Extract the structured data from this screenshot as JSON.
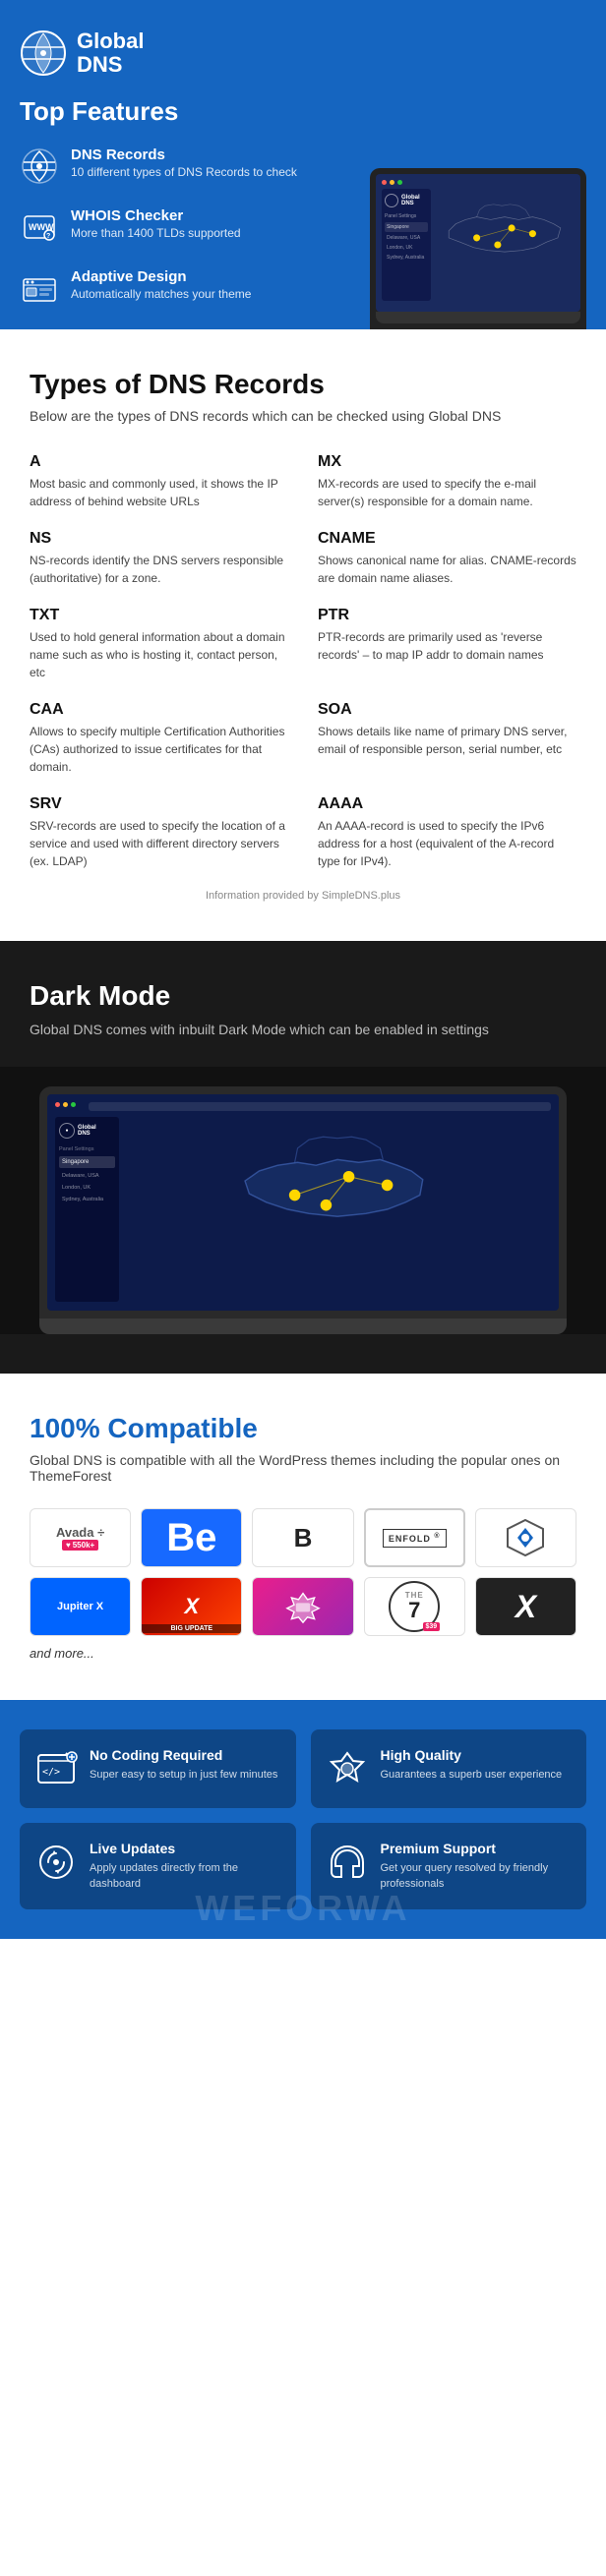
{
  "header": {
    "logo_line1": "Global",
    "logo_line2": "DNS",
    "section_title": "Top Features"
  },
  "features": [
    {
      "title": "DNS Records",
      "description": "10 different types of DNS Records to check",
      "icon": "dns"
    },
    {
      "title": "WHOIS Checker",
      "description": "More than 1400 TLDs supported",
      "icon": "whois"
    },
    {
      "title": "Adaptive Design",
      "description": "Automatically matches your theme",
      "icon": "adaptive"
    }
  ],
  "dns_section": {
    "title": "Types of DNS Records",
    "subtitle": "Below are the types of DNS records which can be checked using Global DNS",
    "records": [
      {
        "type": "A",
        "description": "Most basic and commonly used, it shows the IP address of behind website URLs"
      },
      {
        "type": "MX",
        "description": "MX-records are used to specify the e-mail server(s) responsible for a domain name."
      },
      {
        "type": "NS",
        "description": "NS-records identify the DNS servers responsible (authoritative) for a zone."
      },
      {
        "type": "CNAME",
        "description": "Shows canonical name for alias. CNAME-records are domain name aliases."
      },
      {
        "type": "TXT",
        "description": "Used to hold general information about a domain name such as who is hosting it, contact person, etc"
      },
      {
        "type": "PTR",
        "description": "PTR-records are primarily used as 'reverse records' – to map IP addr to domain names"
      },
      {
        "type": "CAA",
        "description": "Allows to specify multiple Certification Authorities (CAs) authorized to issue certificates for that domain."
      },
      {
        "type": "SOA",
        "description": "Shows details like name of primary DNS server, email of responsible person, serial number, etc"
      },
      {
        "type": "SRV",
        "description": "SRV-records are used to specify the location of a service and used with different directory servers (ex. LDAP)"
      },
      {
        "type": "AAAA",
        "description": "An AAAA-record is used to specify the IPv6 address for a host (equivalent of the A-record type for IPv4)."
      }
    ],
    "info_source": "Information provided by SimpleDNS.plus"
  },
  "dark_mode_section": {
    "title": "Dark Mode",
    "subtitle": "Global DNS comes with inbuilt Dark Mode which can be enabled in settings"
  },
  "compatible_section": {
    "title": "100% Compatible",
    "subtitle": "Global DNS is compatible with all the WordPress themes including the popular ones on ThemeForest",
    "themes": [
      {
        "name": "Avada",
        "badge": "550k+"
      },
      {
        "name": "Behance",
        "display": "Be"
      },
      {
        "name": "Bridge",
        "display": "B"
      },
      {
        "name": "Enfold",
        "display": "ENFOLD"
      },
      {
        "name": "Divi"
      },
      {
        "name": "Jupiter X"
      },
      {
        "name": "XTemos"
      },
      {
        "name": "WoodMart"
      },
      {
        "name": "The7",
        "display": "7"
      },
      {
        "name": "X Theme",
        "display": "X"
      }
    ],
    "and_more": "and more..."
  },
  "cards": [
    {
      "title": "No Coding Required",
      "description": "Super easy to setup in just few minutes",
      "icon": "no-coding"
    },
    {
      "title": "High Quality",
      "description": "Guarantees a superb user experience",
      "icon": "high-quality"
    },
    {
      "title": "Live Updates",
      "description": "Apply updates directly from the dashboard",
      "icon": "live-updates"
    },
    {
      "title": "Premium Support",
      "description": "Get your query resolved by friendly professionals",
      "icon": "premium-support"
    }
  ]
}
